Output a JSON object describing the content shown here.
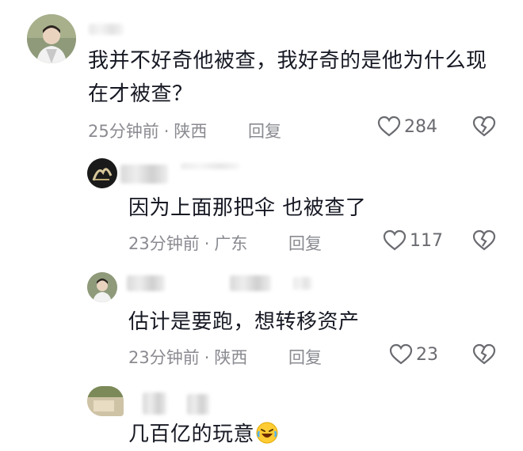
{
  "comments": [
    {
      "text": "我并不好奇他被查，我好奇的是他为什么现在才被查？",
      "time": "25分钟前",
      "location": "陕西",
      "reply_label": "回复",
      "likes": "284"
    },
    {
      "text": "因为上面那把伞  也被查了",
      "time": "23分钟前",
      "location": "广东",
      "reply_label": "回复",
      "likes": "117"
    },
    {
      "text": "估计是要跑，想转移资产",
      "time": "23分钟前",
      "location": "陕西",
      "reply_label": "回复",
      "likes": "23"
    },
    {
      "text": "几百亿的玩意",
      "emoji": "laughing-crying-emoji"
    }
  ],
  "meta_separator": "·",
  "colors": {
    "text": "#161823",
    "meta": "#8a8b91",
    "icon": "#6a6b70"
  }
}
